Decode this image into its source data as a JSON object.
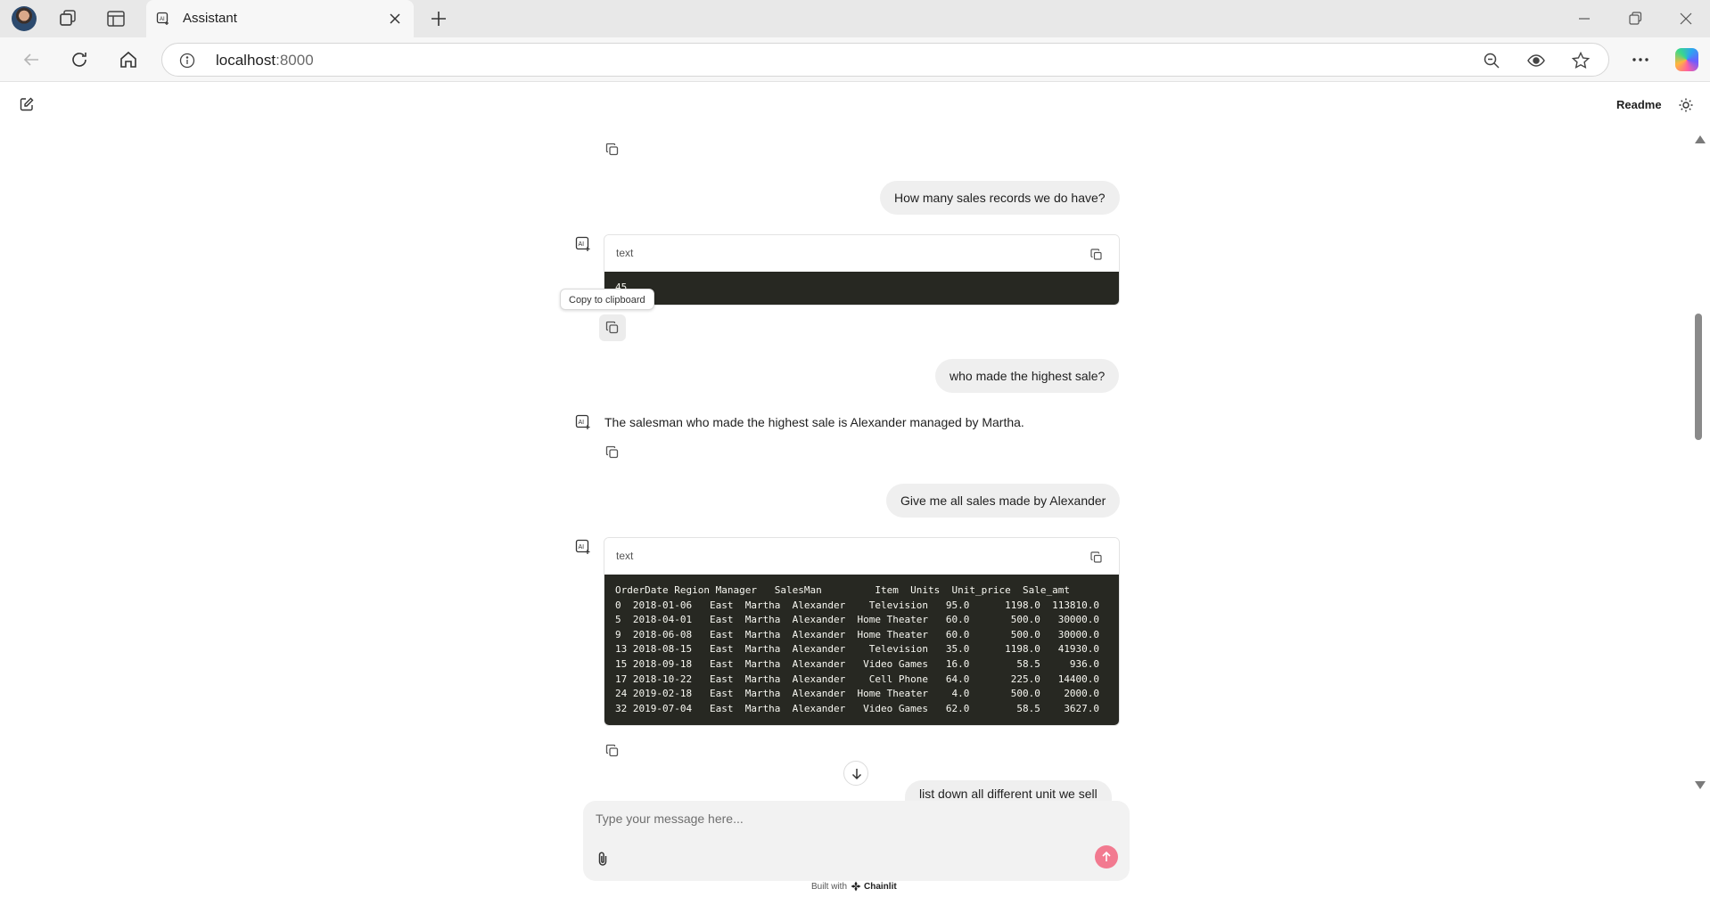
{
  "browser": {
    "tab_title": "Assistant",
    "url_host": "localhost",
    "url_port": ":8000"
  },
  "app": {
    "readme_label": "Readme",
    "composer_placeholder": "Type your message here...",
    "built_with": "Built with",
    "brand": "Chainlit",
    "tooltip": "Copy to clipboard"
  },
  "messages": {
    "user1": "How many sales records we do have?",
    "code1_lang": "text",
    "code1_body": "45",
    "user2": "who made the highest sale?",
    "assistant2": "The salesman who made the highest sale is Alexander managed by Martha.",
    "user3": "Give me all sales made by Alexander",
    "code2_lang": "text",
    "code2_body": "OrderDate Region Manager   SalesMan         Item  Units  Unit_price  Sale_amt\n0  2018-01-06   East  Martha  Alexander    Television   95.0      1198.0  113810.0\n5  2018-04-01   East  Martha  Alexander  Home Theater   60.0       500.0   30000.0\n9  2018-06-08   East  Martha  Alexander  Home Theater   60.0       500.0   30000.0\n13 2018-08-15   East  Martha  Alexander    Television   35.0      1198.0   41930.0\n15 2018-09-18   East  Martha  Alexander   Video Games   16.0        58.5     936.0\n17 2018-10-22   East  Martha  Alexander    Cell Phone   64.0       225.0   14400.0\n24 2019-02-18   East  Martha  Alexander  Home Theater    4.0       500.0    2000.0\n32 2019-07-04   East  Martha  Alexander   Video Games   62.0        58.5    3627.0",
    "user4": "list down all different unit we sell"
  },
  "icons": {
    "copy": "copy-icon",
    "assistant": "assistant-avatar-icon",
    "edit": "new-chat-icon",
    "theme": "sun-icon",
    "attach": "paperclip-icon",
    "send": "arrow-up-icon",
    "scroll": "arrow-down-icon"
  },
  "colors": {
    "send_button": "#f27a90",
    "code_background": "#272822",
    "user_bubble": "#efefef"
  }
}
